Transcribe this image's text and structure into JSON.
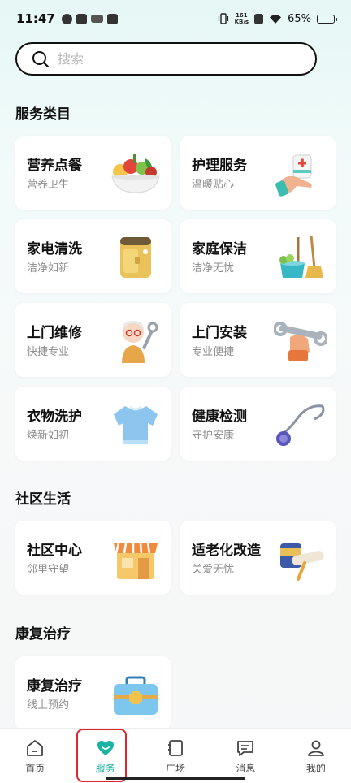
{
  "status_bar": {
    "time": "11:47",
    "net_speed_value": "161",
    "net_speed_unit": "KB/s",
    "battery": "65%",
    "battery_level": 0.65
  },
  "search": {
    "placeholder": "搜索",
    "value": ""
  },
  "sections": {
    "services": {
      "title": "服务类目",
      "cards": [
        {
          "title": "营养点餐",
          "subtitle": "营养卫生",
          "icon": "fruit-bowl-icon"
        },
        {
          "title": "护理服务",
          "subtitle": "温暖贴心",
          "icon": "care-hand-icon"
        },
        {
          "title": "家电清洗",
          "subtitle": "洁净如新",
          "icon": "appliance-icon"
        },
        {
          "title": "家庭保洁",
          "subtitle": "洁净无忧",
          "icon": "cleaning-tools-icon"
        },
        {
          "title": "上门维修",
          "subtitle": "快捷专业",
          "icon": "repairman-icon"
        },
        {
          "title": "上门安装",
          "subtitle": "专业便捷",
          "icon": "wrench-hand-icon"
        },
        {
          "title": "衣物洗护",
          "subtitle": "焕新如初",
          "icon": "sweater-icon"
        },
        {
          "title": "健康检测",
          "subtitle": "守护安康",
          "icon": "stethoscope-icon"
        }
      ]
    },
    "community": {
      "title": "社区生活",
      "cards": [
        {
          "title": "社区中心",
          "subtitle": "邻里守望",
          "icon": "storefront-icon"
        },
        {
          "title": "适老化改造",
          "subtitle": "关爱无忧",
          "icon": "paint-roller-icon"
        }
      ]
    },
    "rehab": {
      "title": "康复治疗",
      "cards": [
        {
          "title": "康复治疗",
          "subtitle": "线上预约",
          "icon": "medical-kit-icon"
        }
      ]
    }
  },
  "bottom_nav": {
    "active": "服务",
    "accent_color": "#19b3a3",
    "items": [
      {
        "label": "首页",
        "icon": "home-icon"
      },
      {
        "label": "服务",
        "icon": "heart-icon"
      },
      {
        "label": "广场",
        "icon": "book-icon"
      },
      {
        "label": "消息",
        "icon": "message-icon"
      },
      {
        "label": "我的",
        "icon": "user-icon"
      }
    ]
  },
  "highlight_color": "#e0262a"
}
